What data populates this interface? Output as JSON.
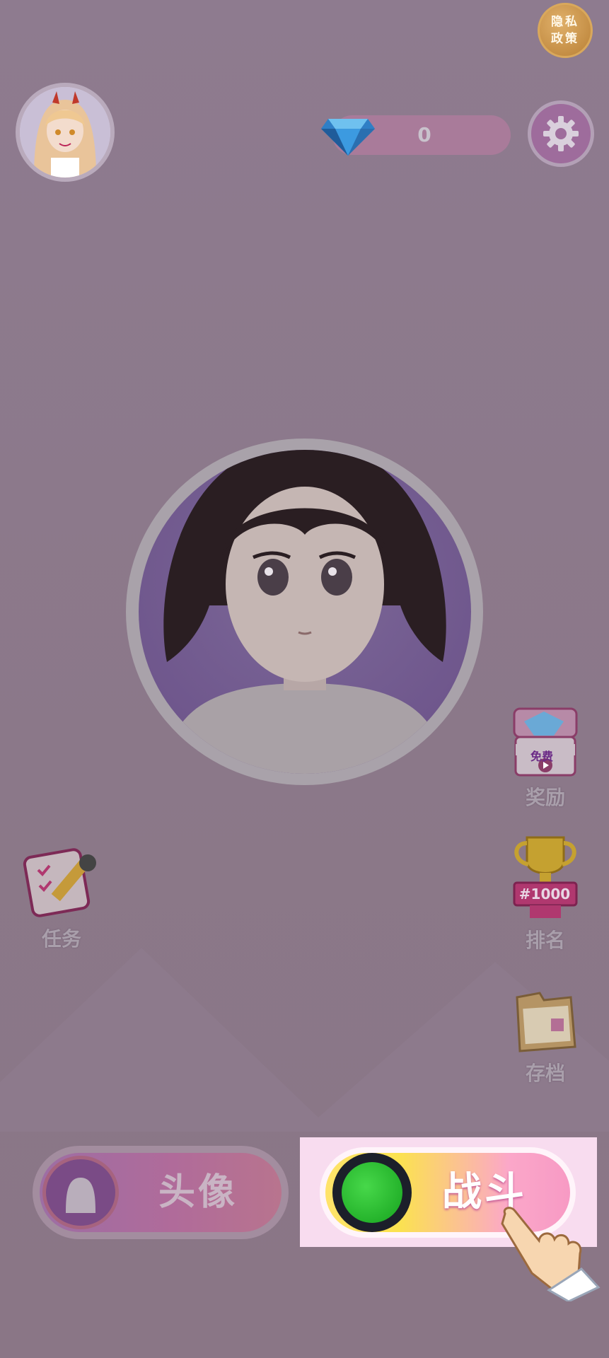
{
  "header": {
    "privacy_policy_line1": "隐私",
    "privacy_policy_line2": "政策",
    "gem_count": "0"
  },
  "side_menu": {
    "rewards": {
      "badge": "免费",
      "label": "奖励"
    },
    "ranking": {
      "rank_badge": "#1000",
      "label": "排名"
    },
    "archive": {
      "label": "存档"
    },
    "tasks": {
      "label": "任务"
    }
  },
  "bottom_buttons": {
    "avatar_label": "头像",
    "fight_label": "战斗"
  },
  "icons": {
    "gem": "gem-icon",
    "settings": "gear-icon",
    "rewards": "gift-box-icon",
    "ranking": "trophy-icon",
    "archive": "folder-icon",
    "tasks": "checklist-icon",
    "avatar": "avatar-silhouette-icon",
    "fight": "radar-icon",
    "tutorial": "pointing-hand-icon"
  },
  "colors": {
    "background": "#8f7d90",
    "fight_gradient_start": "#ffe36b",
    "fight_gradient_end": "#f79ac4",
    "avatar_button": "#b06b9a"
  }
}
